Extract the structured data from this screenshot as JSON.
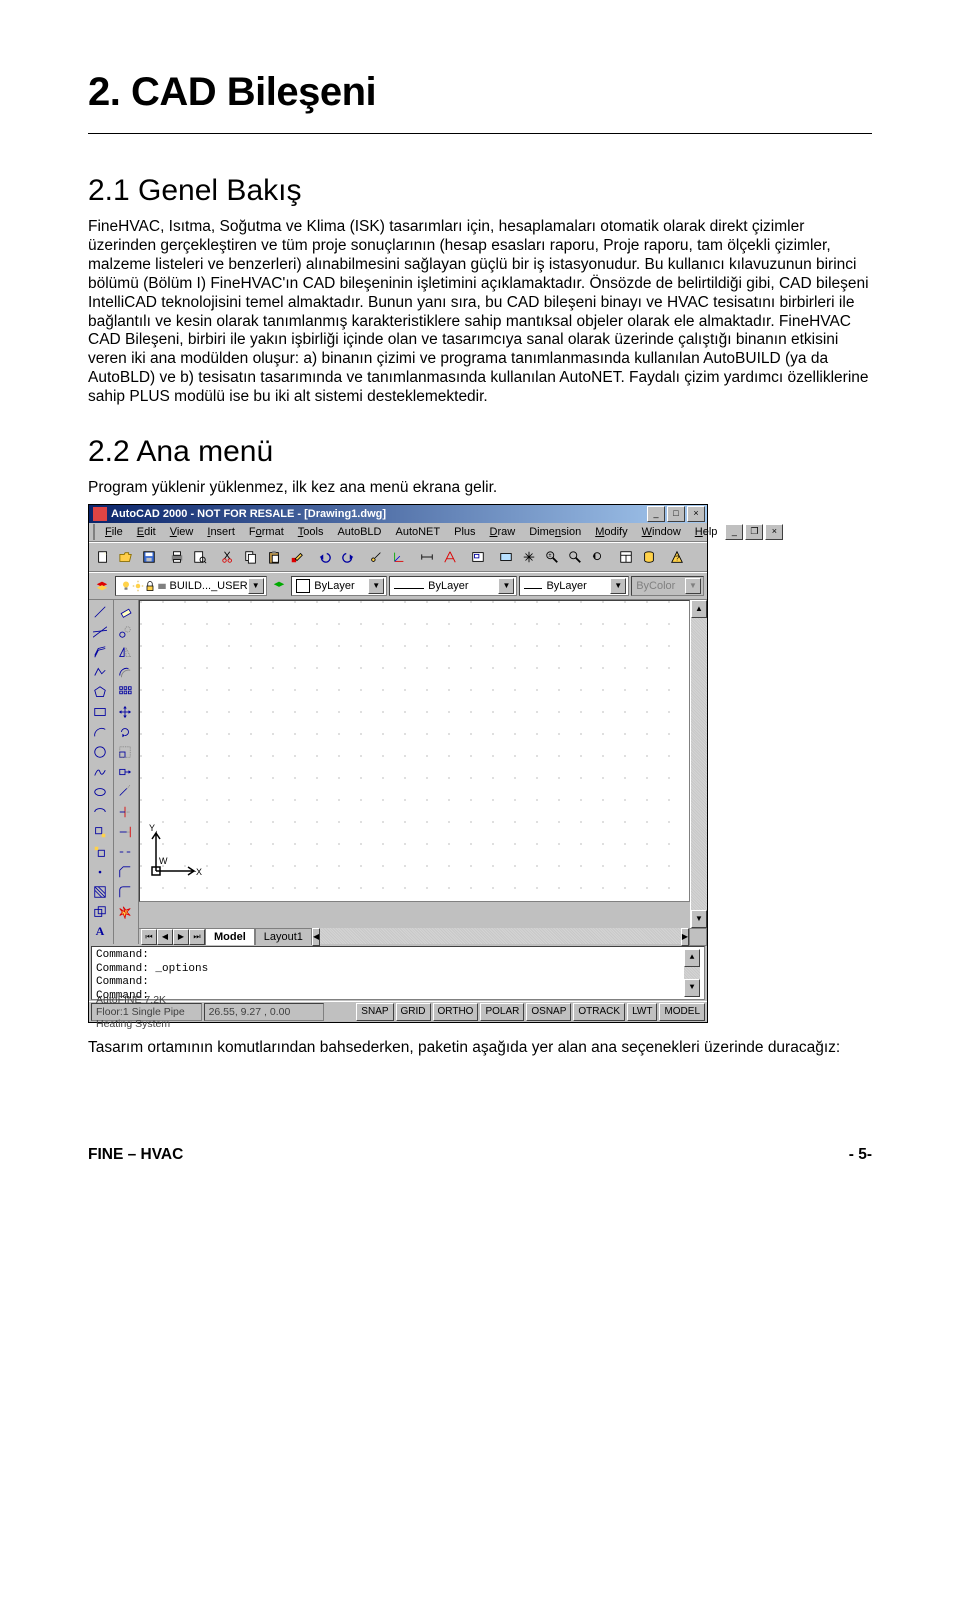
{
  "chapter_title": "2. CAD Bileşeni",
  "section1_title": "2.1 Genel Bakış",
  "body_para": "FineHVAC, Isıtma, Soğutma ve Klima (ISK) tasarımları için, hesaplamaları otomatik olarak direkt çizimler üzerinden gerçekleştiren ve tüm proje sonuçlarının (hesap esasları raporu, Proje raporu, tam ölçekli çizimler, malzeme listeleri ve benzerleri) alınabilmesini sağlayan güçlü bir iş istasyonudur. Bu kullanıcı kılavuzunun birinci bölümü (Bölüm I) FineHVAC'ın CAD bileşeninin işletimini açıklamaktadır. Önsözde de belirtildiği gibi, CAD bileşeni IntelliCAD teknolojisini temel almaktadır. Bunun yanı sıra, bu CAD bileşeni binayı ve HVAC tesisatını birbirleri ile bağlantılı ve kesin olarak tanımlanmış karakteristiklere sahip mantıksal objeler olarak ele almaktadır. FineHVAC CAD Bileşeni, birbiri ile yakın işbirliği içinde olan ve tasarımcıya sanal olarak üzerinde çalıştığı binanın etkisini veren iki ana modülden oluşur: a) binanın çizimi ve programa tanımlanmasında kullanılan AutoBUILD (ya da AutoBLD) ve b) tesisatın tasarımında ve tanımlanmasında kullanılan AutoNET. Faydalı çizim yardımcı özelliklerine sahip PLUS modülü ise bu iki alt sistemi desteklemektedir.",
  "section2_title": "2.2 Ana menü",
  "intro_line": "Program yüklenir yüklenmez,  ilk kez ana menü ekrana gelir.",
  "closing_line": "Tasarım ortamının komutlarından bahsederken, paketin aşağıda yer alan ana seçenekleri üzerinde duracağız:",
  "footer_left": "FINE – HVAC",
  "footer_right": "- 5-",
  "shot": {
    "title": "AutoCAD 2000 - NOT FOR RESALE - [Drawing1.dwg]",
    "menus": [
      "File",
      "Edit",
      "View",
      "Insert",
      "Format",
      "Tools",
      "AutoBLD",
      "AutoNET",
      "Plus",
      "Draw",
      "Dimension",
      "Modify",
      "Window",
      "Help"
    ],
    "layer_dd": "BUILD..._USER",
    "color_dd": "ByLayer",
    "ltype_dd": "ByLayer",
    "lweight_dd": "ByLayer",
    "plot_dd": "ByColor",
    "tabs": {
      "nav": [
        "⏮",
        "◀",
        "▶",
        "⏭"
      ],
      "model": "Model",
      "layout": "Layout1"
    },
    "cmd": [
      "Command:",
      "Command: _options",
      "Command:",
      "Command:"
    ],
    "status_well": "AutoFINE 7.2K Floor:1 Single Pipe Heating System",
    "coords": "26.55, 9.27 , 0.00",
    "status_btns": [
      "SNAP",
      "GRID",
      "ORTHO",
      "POLAR",
      "OSNAP",
      "OTRACK",
      "LWT",
      "MODEL"
    ]
  }
}
